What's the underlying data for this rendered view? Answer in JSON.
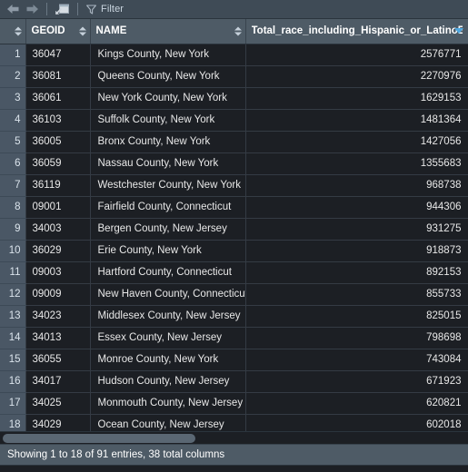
{
  "toolbar": {
    "back_icon": "arrow-left-icon",
    "forward_icon": "arrow-right-icon",
    "popout_icon": "open-in-new-window-icon",
    "filter_icon": "funnel-icon",
    "filter_label": "Filter"
  },
  "table": {
    "columns": [
      {
        "key": "rownum",
        "label": "",
        "sortable": true,
        "sort": "none",
        "align": "right"
      },
      {
        "key": "geoid",
        "label": "GEOID",
        "sortable": true,
        "sort": "none",
        "align": "left"
      },
      {
        "key": "name",
        "label": "NAME",
        "sortable": true,
        "sort": "none",
        "align": "left"
      },
      {
        "key": "total",
        "label": "Total_race_including_Hispanic_or_LatinoE",
        "sortable": true,
        "sort": "desc",
        "align": "right"
      }
    ],
    "rows": [
      {
        "n": "1",
        "geoid": "36047",
        "name": "Kings County, New York",
        "total": "2576771"
      },
      {
        "n": "2",
        "geoid": "36081",
        "name": "Queens County, New York",
        "total": "2270976"
      },
      {
        "n": "3",
        "geoid": "36061",
        "name": "New York County, New York",
        "total": "1629153"
      },
      {
        "n": "4",
        "geoid": "36103",
        "name": "Suffolk County, New York",
        "total": "1481364"
      },
      {
        "n": "5",
        "geoid": "36005",
        "name": "Bronx County, New York",
        "total": "1427056"
      },
      {
        "n": "6",
        "geoid": "36059",
        "name": "Nassau County, New York",
        "total": "1355683"
      },
      {
        "n": "7",
        "geoid": "36119",
        "name": "Westchester County, New York",
        "total": "968738"
      },
      {
        "n": "8",
        "geoid": "09001",
        "name": "Fairfield County, Connecticut",
        "total": "944306"
      },
      {
        "n": "9",
        "geoid": "34003",
        "name": "Bergen County, New Jersey",
        "total": "931275"
      },
      {
        "n": "10",
        "geoid": "36029",
        "name": "Erie County, New York",
        "total": "918873"
      },
      {
        "n": "11",
        "geoid": "09003",
        "name": "Hartford County, Connecticut",
        "total": "892153"
      },
      {
        "n": "12",
        "geoid": "09009",
        "name": "New Haven County, Connecticut",
        "total": "855733"
      },
      {
        "n": "13",
        "geoid": "34023",
        "name": "Middlesex County, New Jersey",
        "total": "825015"
      },
      {
        "n": "14",
        "geoid": "34013",
        "name": "Essex County, New Jersey",
        "total": "798698"
      },
      {
        "n": "15",
        "geoid": "36055",
        "name": "Monroe County, New York",
        "total": "743084"
      },
      {
        "n": "16",
        "geoid": "34017",
        "name": "Hudson County, New Jersey",
        "total": "671923"
      },
      {
        "n": "17",
        "geoid": "34025",
        "name": "Monmouth County, New Jersey",
        "total": "620821"
      },
      {
        "n": "18",
        "geoid": "34029",
        "name": "Ocean County, New Jersey",
        "total": "602018"
      }
    ]
  },
  "scrollbar": {
    "horizontal_name": "horizontal-scrollbar"
  },
  "status": {
    "text": "Showing 1 to 18 of 91 entries, 38 total columns"
  },
  "colors": {
    "toolbar_bg": "#3f4b56",
    "header_bg": "#4e5b66",
    "cell_bg": "#1c1f24",
    "rownum_bg": "#4a5765",
    "grid_line": "#343b44",
    "text": "#e8e8e8",
    "sort_accent": "#4fa8e0",
    "scroll_thumb": "#5a6773"
  }
}
